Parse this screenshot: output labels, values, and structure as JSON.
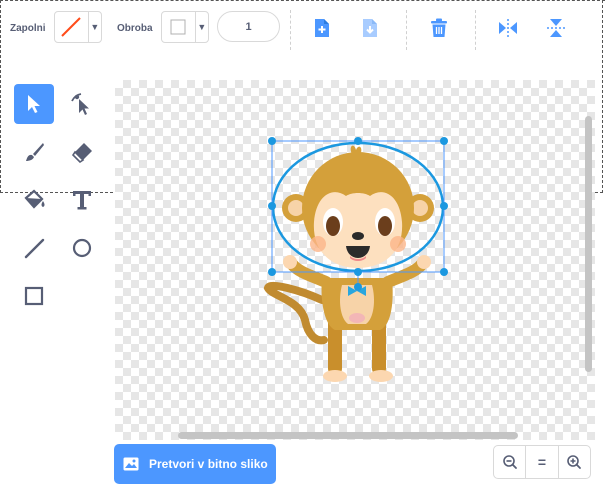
{
  "toolbar": {
    "fill_label": "Zapolni",
    "outline_label": "Obroba",
    "outline_width": "1",
    "fill_color": "#ff8c1a",
    "outline_color": "#ffffff"
  },
  "tools": [
    {
      "name": "select-tool",
      "icon": "arrow-pointer-icon",
      "active": true
    },
    {
      "name": "reshape-tool",
      "icon": "reshape-icon",
      "active": false
    },
    {
      "name": "brush-tool",
      "icon": "brush-icon",
      "active": false
    },
    {
      "name": "eraser-tool",
      "icon": "eraser-icon",
      "active": false
    },
    {
      "name": "fill-tool",
      "icon": "paint-bucket-icon",
      "active": false
    },
    {
      "name": "text-tool",
      "icon": "text-icon",
      "active": false
    },
    {
      "name": "line-tool",
      "icon": "line-icon",
      "active": false
    },
    {
      "name": "circle-tool",
      "icon": "circle-icon",
      "active": false
    },
    {
      "name": "rectangle-tool",
      "icon": "rectangle-icon",
      "active": false
    }
  ],
  "bottom": {
    "convert_label": "Pretvori v bitno sliko",
    "zoom_reset": "="
  },
  "colors": {
    "accent": "#4c97ff",
    "selection": "#1b98e0",
    "text": "#575e75"
  }
}
